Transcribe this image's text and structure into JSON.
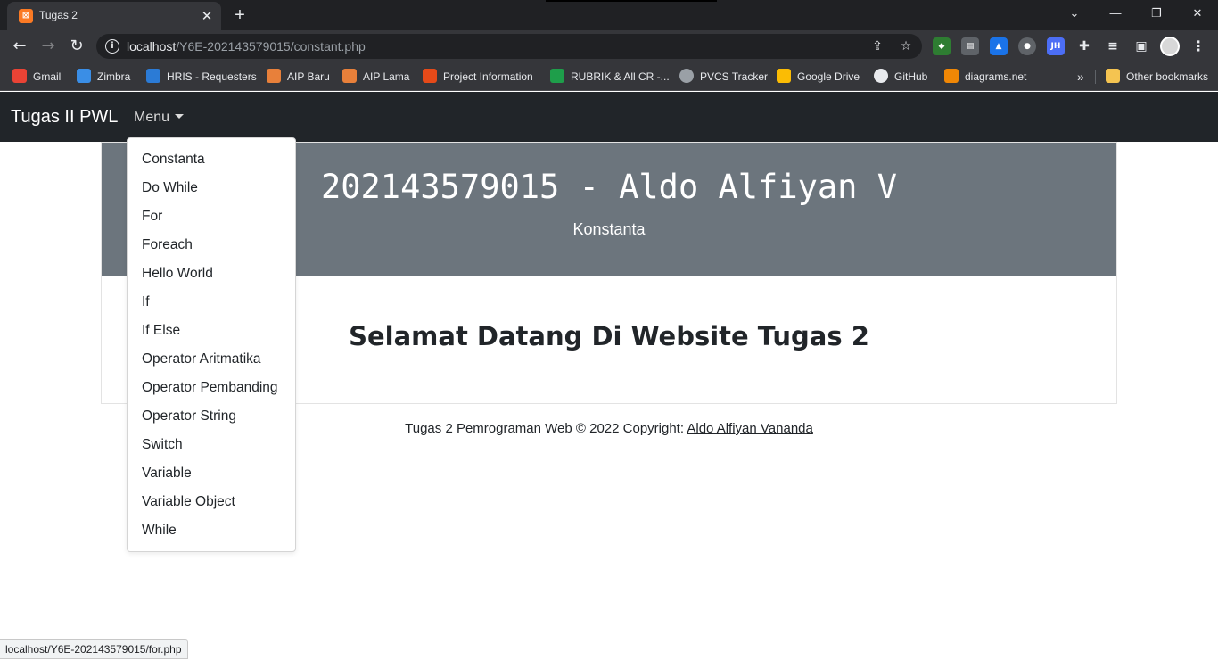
{
  "browser": {
    "tab_title": "Tugas 2",
    "tab_close": "✕",
    "new_tab": "+",
    "window_controls": {
      "tabsearch": "⌄",
      "minimize": "—",
      "restore": "❐",
      "close": "✕"
    },
    "url_host": "localhost",
    "url_path": "/Y6E-202143579015/constant.php",
    "bookmarks": [
      {
        "label": "Gmail",
        "color": "#ea4335"
      },
      {
        "label": "Zimbra",
        "color": "#3a8ee6"
      },
      {
        "label": "HRIS - Requesters",
        "color": "#2b7bd6"
      },
      {
        "label": "AIP Baru",
        "color": "#e8803a"
      },
      {
        "label": "AIP Lama",
        "color": "#e8803a"
      },
      {
        "label": "Project Information",
        "color": "#e64a19"
      },
      {
        "label": "RUBRIK & All CR -...",
        "color": "#1e9e4a"
      },
      {
        "label": "PVCS Tracker",
        "color": "#9aa0a6"
      },
      {
        "label": "Google Drive",
        "color": "#fbbc04"
      },
      {
        "label": "GitHub",
        "color": "#e8eaed"
      },
      {
        "label": "diagrams.net",
        "color": "#f08705"
      }
    ],
    "bookmarks_overflow": "»",
    "other_bookmarks": "Other bookmarks",
    "status_url": "localhost/Y6E-202143579015/for.php"
  },
  "page": {
    "brand": "Tugas II PWL",
    "menu_label": "Menu",
    "hero_title": "202143579015 - Aldo Alfiyan V",
    "hero_subtitle": "Konstanta",
    "welcome": "Selamat Datang Di Website Tugas 2",
    "footer_text": "Tugas 2 Pemrograman Web © 2022 Copyright: ",
    "footer_link": "Aldo Alfiyan Vananda",
    "menu_items": [
      "Constanta",
      "Do While",
      "For",
      "Foreach",
      "Hello World",
      "If",
      "If Else",
      "Operator Aritmatika",
      "Operator Pembanding",
      "Operator String",
      "Switch",
      "Variable",
      "Variable Object",
      "While"
    ]
  }
}
